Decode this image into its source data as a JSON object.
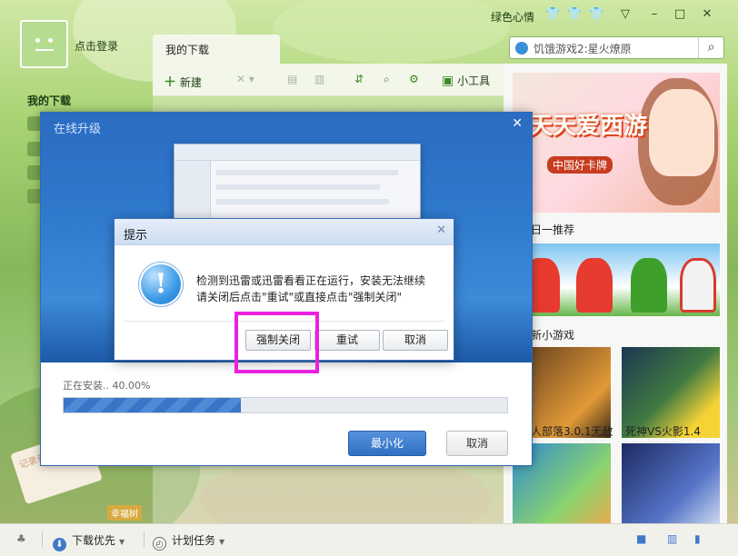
{
  "header": {
    "skin_label": "绿色心情",
    "login_label": "点击登录",
    "active_tab": "我的下载",
    "search_value": "饥饿游戏2:星火燎原"
  },
  "toolbar": {
    "new_label": "新建",
    "tools_label": "小工具"
  },
  "sidebar": {
    "title": "我的下载"
  },
  "ads": {
    "banner_logo": "天天爱西游",
    "banner_sub": "中国好卡牌",
    "caption1": "日一推荐",
    "caption2": "新小游戏",
    "caption3": "人部落3.0.1无敌",
    "caption4": "死神VS火影1.4"
  },
  "statusbar": {
    "priority_label": "下载优先",
    "schedule_label": "计划任务"
  },
  "upgrade_dialog": {
    "title": "在线升级",
    "status": "正在安装.. 40.00%",
    "progress": 0.4,
    "minimize_label": "最小化",
    "cancel_label": "取消"
  },
  "prompt_dialog": {
    "title": "提示",
    "message_line1": "检测到迅雷或迅雷看看正在运行，安装无法继续",
    "message_line2": "请关闭后点击\"重试\"或直接点击\"强制关闭\"",
    "force_close_label": "强制关闭",
    "retry_label": "重试",
    "cancel_label": "取消"
  },
  "decor": {
    "sticker_text": "记录幸福时光",
    "tree_label": "幸福树"
  },
  "colors": {
    "accent_blue": "#3070c3",
    "highlight": "#ea21e1",
    "app_green": "#86b85a"
  }
}
